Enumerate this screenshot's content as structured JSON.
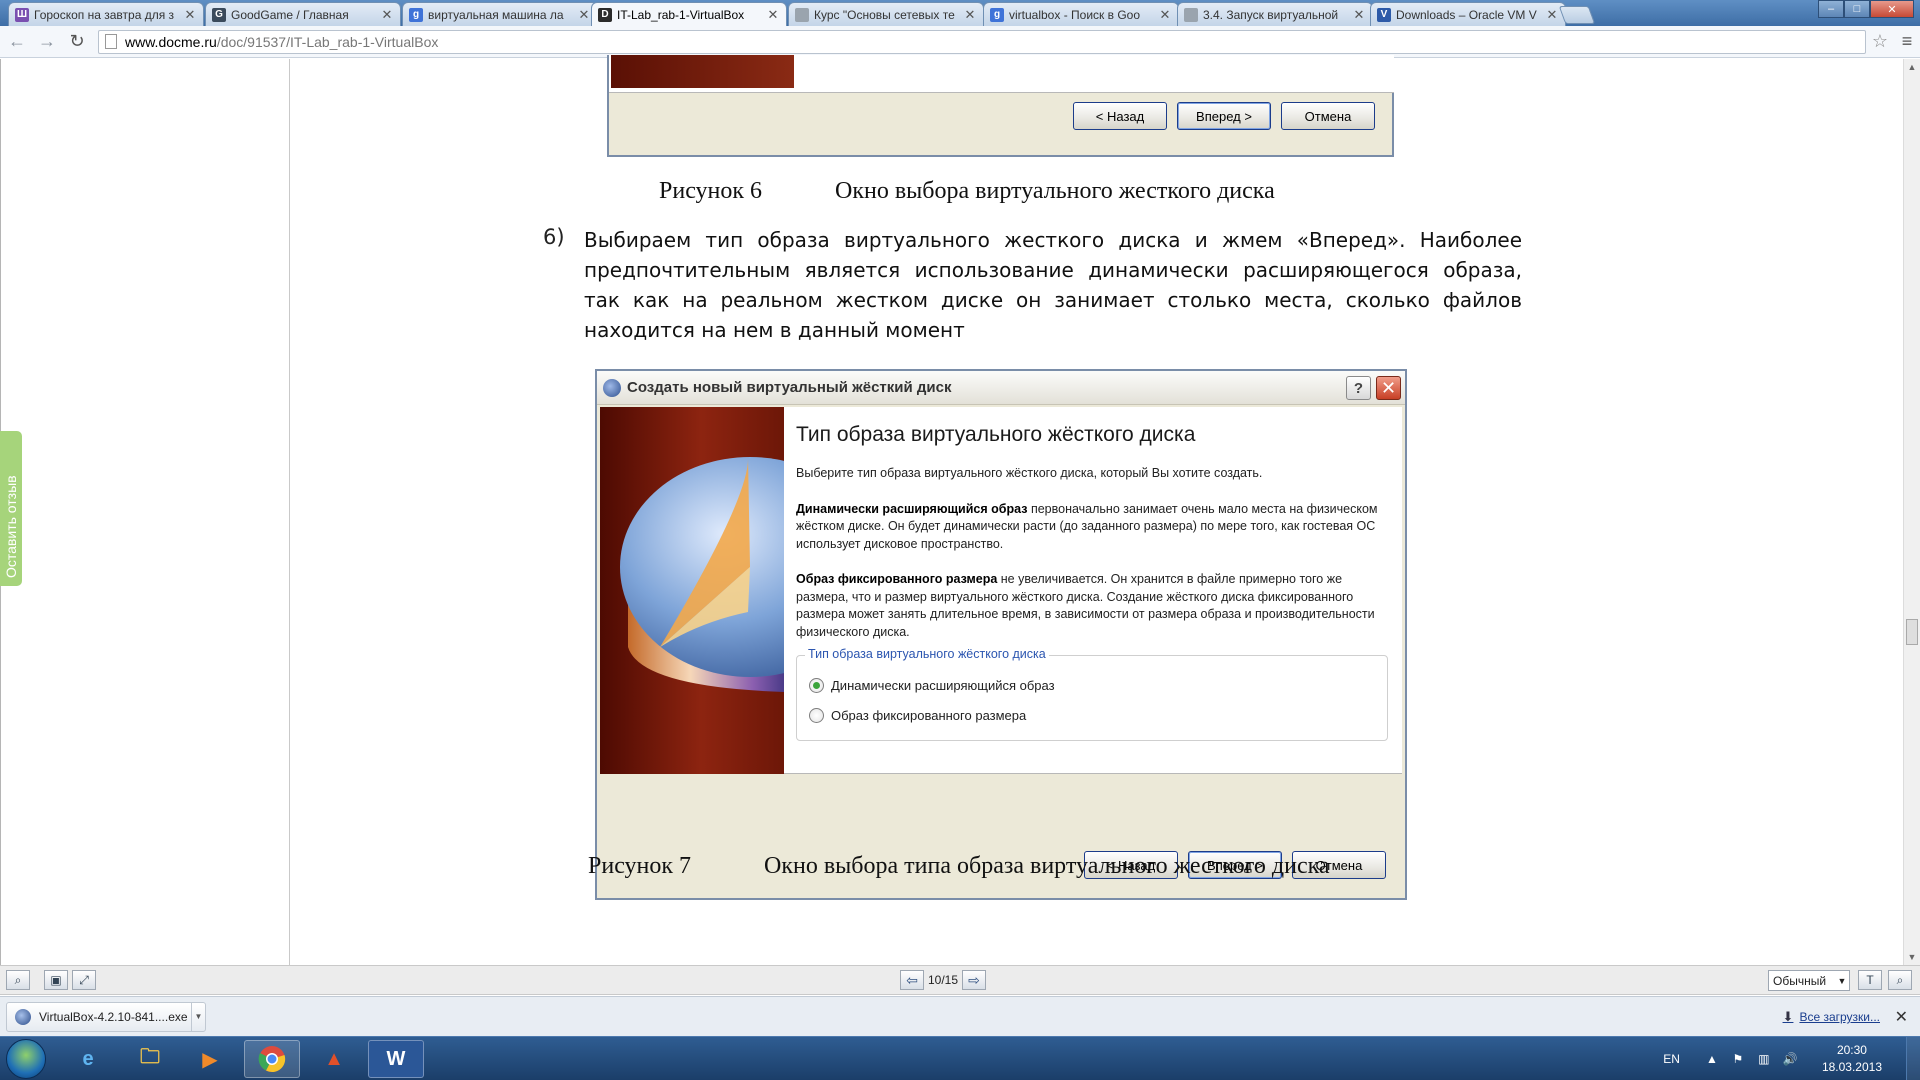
{
  "browser": {
    "tabs": [
      {
        "title": "Гороскоп на завтра для з",
        "favicon": "horoscope-icon",
        "color": "#7a4fb0",
        "glyph": "Ш"
      },
      {
        "title": "GoodGame / Главная",
        "favicon": "goodgame-icon",
        "color": "#3a4a5c",
        "glyph": "G"
      },
      {
        "title": "виртуальная машина ла",
        "favicon": "google-icon",
        "color": "#3f73d8",
        "glyph": "g"
      },
      {
        "title": "IT-Lab_rab-1-VirtualBox",
        "favicon": "docme-icon",
        "color": "#2b2b2b",
        "glyph": "D"
      },
      {
        "title": "Курс \"Основы сетевых те",
        "favicon": "page-icon",
        "color": "#9aa4ae",
        "glyph": ""
      },
      {
        "title": "virtualbox - Поиск в Goo",
        "favicon": "google-icon",
        "color": "#3f73d8",
        "glyph": "g"
      },
      {
        "title": "3.4. Запуск виртуальной",
        "favicon": "page-icon",
        "color": "#9aa4ae",
        "glyph": ""
      },
      {
        "title": "Downloads – Oracle VM V",
        "favicon": "virtualbox-icon",
        "color": "#2d5aa8",
        "glyph": "V"
      }
    ],
    "active_tab": 3,
    "url_host": "www.docme.ru",
    "url_path": "/doc/91537/IT-Lab_rab-1-VirtualBox"
  },
  "document": {
    "fig6_buttons": {
      "back": "< Назад",
      "next": "Вперед >",
      "cancel": "Отмена"
    },
    "fig6_caption_num": "Рисунок 6",
    "fig6_caption_text": "Окно выбора виртуального жесткого диска",
    "step_number": "6)",
    "step_text": "Выбираем тип образа виртуального жесткого диска и жмем «Вперед». Наиболее предпочтительным является использование динамически расширяющегося образа, так как на реальном жестком диске он занимает столько места, сколько файлов находится на нем в данный момент",
    "dialog": {
      "title": "Создать новый виртуальный жёсткий диск",
      "help": "?",
      "close": "✕",
      "heading": "Тип образа виртуального жёсткого диска",
      "intro": "Выберите тип образа виртуального жёсткого диска, который Вы хотите создать.",
      "dyn_bold": "Динамически расширяющийся образ",
      "dyn_text": " первоначально занимает очень мало места на физическом жёстком диске. Он будет динамически расти (до заданного размера) по мере того, как гостевая ОС использует дисковое пространство.",
      "fixed_bold": "Образ фиксированного размера",
      "fixed_text": " не увеличивается. Он хранится в файле примерно того же размера, что и размер виртуального жёсткого диска. Создание жёсткого диска фиксированного размера может занять длительное время, в зависимости от размера образа и производительности физического диска.",
      "group_label": "Тип образа виртуального жёсткого диска",
      "option_dynamic": "Динамически расширяющийся образ",
      "option_fixed": "Образ фиксированного размера",
      "selected_option": "dynamic",
      "btn_back": "< Назад",
      "btn_next": "Вперед >",
      "btn_cancel": "Отмена"
    },
    "fig7_caption_num": "Рисунок 7",
    "fig7_caption_text": "Окно выбора типа образа виртуального жесткого диска"
  },
  "feedback_label": "Оставить отзыв",
  "viewer_bar": {
    "page_indicator": "10/15",
    "zoom_mode": "Обычный"
  },
  "downloads": {
    "item_name": "VirtualBox-4.2.10-841....exe",
    "all_downloads": "Все загрузки..."
  },
  "taskbar": {
    "language": "EN",
    "time": "20:30",
    "date": "18.03.2013"
  }
}
